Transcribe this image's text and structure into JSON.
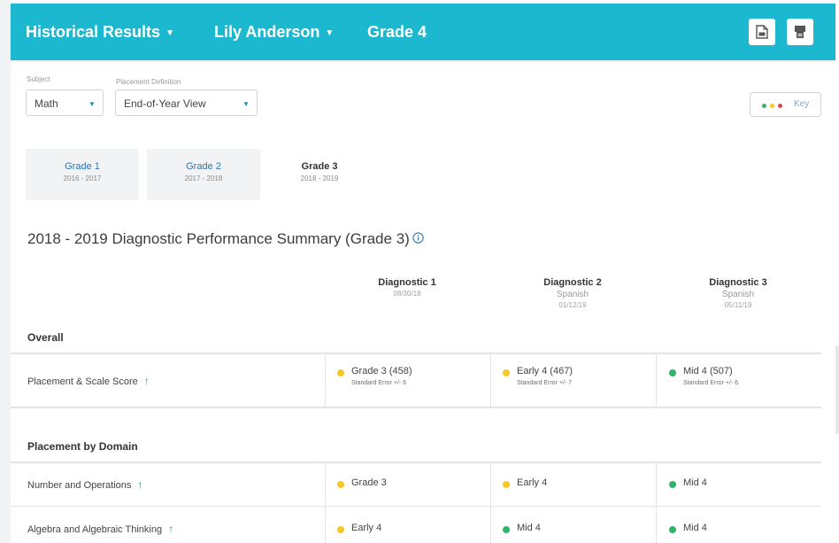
{
  "colors": {
    "header_bg": "#1cb8cf",
    "yellow": "#f4c925",
    "green": "#2fb36d",
    "red": "#e0463c",
    "up_arrow": "#27a36b",
    "link_blue": "#2f73b5"
  },
  "header": {
    "history_label": "Historical Results",
    "student_name": "Lily Anderson",
    "grade_label": "Grade 4",
    "pdf_icon": "pdf-icon",
    "print_icon": "print-icon"
  },
  "filters": {
    "subject_label": "Subject",
    "subject_value": "Math",
    "placement_label": "Placement Definition",
    "placement_value": "End-of-Year View"
  },
  "key": {
    "label": "Key"
  },
  "grade_tabs": [
    {
      "name": "Grade 1",
      "years": "2016 - 2017",
      "active": false
    },
    {
      "name": "Grade 2",
      "years": "2017 - 2018",
      "active": false
    },
    {
      "name": "Grade 3",
      "years": "2018 - 2019",
      "active": true
    }
  ],
  "summary": {
    "title": "2018 - 2019 Diagnostic Performance Summary (Grade 3)"
  },
  "diagnostics": [
    {
      "name": "Diagnostic 1",
      "language": "",
      "date": "08/30/18"
    },
    {
      "name": "Diagnostic 2",
      "language": "Spanish",
      "date": "01/12/19"
    },
    {
      "name": "Diagnostic 3",
      "language": "Spanish",
      "date": "05/11/19"
    }
  ],
  "sections": {
    "overall": "Overall",
    "domain": "Placement by Domain"
  },
  "rows": {
    "placement": {
      "label": "Placement & Scale Score",
      "cells": [
        {
          "text": "Grade 3 (458)",
          "sub": "Standard Error +/- 6",
          "status": "yellow"
        },
        {
          "text": "Early 4 (467)",
          "sub": "Standard Error +/- 7",
          "status": "yellow"
        },
        {
          "text": "Mid 4 (507)",
          "sub": "Standard Error +/- 6",
          "status": "green"
        }
      ]
    },
    "number_ops": {
      "label": "Number and Operations",
      "cells": [
        {
          "text": "Grade 3",
          "status": "yellow"
        },
        {
          "text": "Early 4",
          "status": "yellow"
        },
        {
          "text": "Mid 4",
          "status": "green"
        }
      ]
    },
    "algebra": {
      "label": "Algebra and Algebraic Thinking",
      "cells": [
        {
          "text": "Early 4",
          "status": "yellow"
        },
        {
          "text": "Mid 4",
          "status": "green"
        },
        {
          "text": "Mid 4",
          "status": "green"
        }
      ]
    }
  }
}
